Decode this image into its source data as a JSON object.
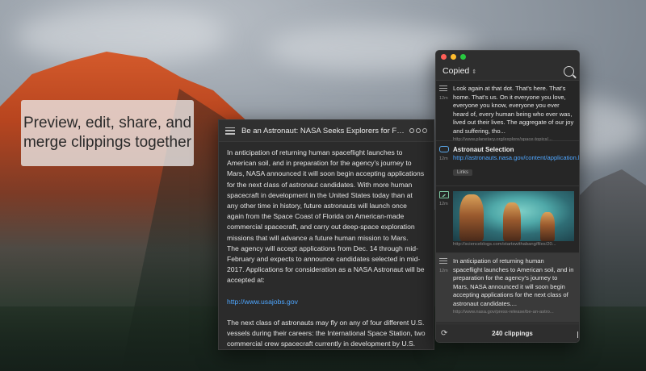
{
  "caption": {
    "text": "Preview, edit, share, and merge clippings together"
  },
  "preview": {
    "title": "Be an Astronaut: NASA Seeks Explorers for Future Spa...",
    "paragraph1": "In anticipation of returning human spaceflight launches to American soil, and in preparation for the agency's journey to Mars, NASA announced it will soon begin accepting applications for the next class of astronaut candidates. With more human spacecraft in development in the United States today than at any other time in history, future astronauts will launch once again from the Space Coast of Florida on American-made commercial spacecraft, and carry out deep-space exploration missions that will advance a future human mission to Mars.",
    "paragraph2": "The agency will accept applications from Dec. 14 through mid-February and expects to announce candidates selected in mid-2017. Applications for consideration as a NASA Astronaut will be accepted at:",
    "link": "http://www.usajobs.gov",
    "paragraph3": "The next class of astronauts may fly on any of four different U.S. vessels during their careers: the International Space Station, two commercial crew spacecraft currently in development by U.S. companies, and NASA's Orion deep-space exploration vehicle."
  },
  "clipboard": {
    "filter_label": "Copied",
    "count_label": "240 clippings",
    "clips": [
      {
        "kind": "text-icon",
        "age": "12m",
        "text": "Look again at that dot. That's here. That's home. That's us. On it everyone you love, everyone you know, everyone you ever heard of, every human being who ever was, lived out their lives. The aggregate of our joy and suffering, tho...",
        "source": "http://www.planetary.org/explore/space-topics/..."
      },
      {
        "kind": "link-icon",
        "age": "12m",
        "title": "Astronaut Selection",
        "link": "http://astronauts.nasa.gov/content/application.htm",
        "tag": "Links"
      },
      {
        "kind": "image-icon",
        "age": "12m",
        "source": "http://scienceblogs.com/startswithabang/files/20..."
      },
      {
        "kind": "text-icon",
        "age": "12m",
        "text": "In anticipation of returning human spaceflight launches to American soil, and in preparation for the agency's journey to Mars, NASA announced it will soon begin accepting applications for the next class of astronaut candidates....",
        "source": "http://www.nasa.gov/press-release/be-an-astro..."
      }
    ]
  }
}
